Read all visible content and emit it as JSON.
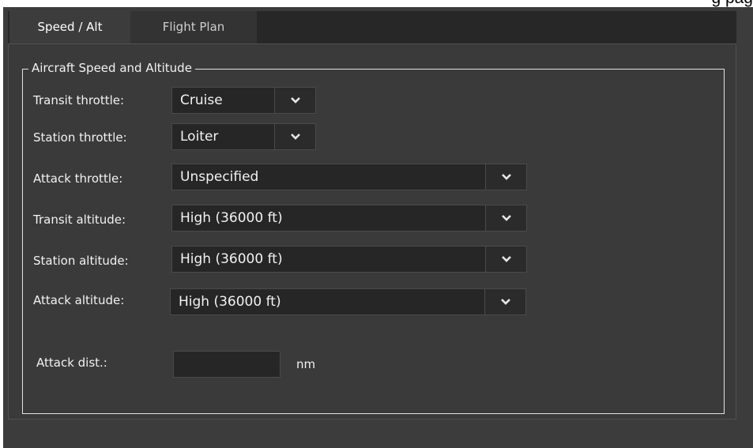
{
  "corner_text": "g pag",
  "tabs": [
    {
      "label": "Speed / Alt",
      "active": true
    },
    {
      "label": "Flight Plan",
      "active": false
    }
  ],
  "group": {
    "title": "Aircraft Speed and Altitude"
  },
  "fields": {
    "transit_throttle": {
      "label": "Transit throttle:",
      "value": "Cruise"
    },
    "station_throttle": {
      "label": "Station throttle:",
      "value": "Loiter"
    },
    "attack_throttle": {
      "label": "Attack throttle:",
      "value": "Unspecified"
    },
    "transit_altitude": {
      "label": "Transit altitude:",
      "value": "High (36000 ft)"
    },
    "station_altitude": {
      "label": "Station altitude:",
      "value": "High (36000 ft)"
    },
    "attack_altitude": {
      "label": "Attack altitude:",
      "value": "High (36000 ft)"
    },
    "attack_dist": {
      "label": "Attack dist.:",
      "value": "",
      "unit": "nm"
    }
  },
  "icons": {
    "dropdown": "chevron-down-icon"
  },
  "colors": {
    "window_bg": "#3c3c3c",
    "tab_bar_bg": "#272727",
    "field_bg": "#262626",
    "text": "#f2f2f2",
    "group_border": "#e4e4e4"
  }
}
